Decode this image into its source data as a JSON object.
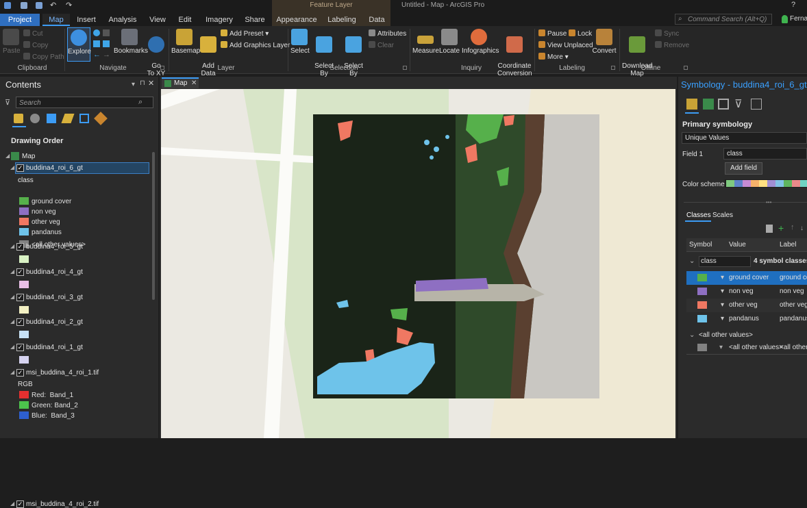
{
  "titlebar": {
    "title": "Untitled - Map - ArcGIS Pro",
    "help": "?"
  },
  "context_tab": {
    "label": "Feature Layer"
  },
  "tabs": [
    {
      "label": "Project"
    },
    {
      "label": "Map"
    },
    {
      "label": "Insert"
    },
    {
      "label": "Analysis"
    },
    {
      "label": "View"
    },
    {
      "label": "Edit"
    },
    {
      "label": "Imagery"
    },
    {
      "label": "Share"
    },
    {
      "label": "Appearance"
    },
    {
      "label": "Labeling"
    },
    {
      "label": "Data"
    }
  ],
  "command_search": {
    "placeholder": "Command Search (Alt+Q)"
  },
  "user": {
    "name": "Fernan"
  },
  "ribbon": {
    "clipboard": {
      "paste": "Paste",
      "cut": "Cut",
      "copy": "Copy",
      "copy_path": "Copy Path",
      "group": "Clipboard"
    },
    "navigate": {
      "explore": "Explore",
      "bookmarks": "Bookmarks",
      "go_to_xy": "Go\nTo XY",
      "group": "Navigate"
    },
    "layer": {
      "basemap": "Basemap",
      "add_data": "Add\nData",
      "add_preset": "Add Preset",
      "add_graphics": "Add Graphics Layer",
      "group": "Layer"
    },
    "selection": {
      "select": "Select",
      "select_by_attr": "Select By\nAttributes",
      "select_by_loc": "Select By\nLocation",
      "attributes": "Attributes",
      "clear": "Clear",
      "group": "Selection"
    },
    "inquiry": {
      "measure": "Measure",
      "locate": "Locate",
      "infographics": "Infographics",
      "coord_conv": "Coordinate\nConversion",
      "group": "Inquiry"
    },
    "labeling": {
      "pause": "Pause",
      "lock": "Lock",
      "view_unplaced": "View Unplaced",
      "more": "More",
      "group": "Labeling"
    },
    "offline": {
      "convert": "Convert",
      "download_map": "Download\nMap",
      "sync": "Sync",
      "remove": "Remove",
      "group": "Offline"
    }
  },
  "contents": {
    "title": "Contents",
    "search_placeholder": "Search",
    "drawing_order": "Drawing Order",
    "map_label": "Map",
    "layers": [
      {
        "name": "buddina4_roi_6_gt",
        "selected": true,
        "field": "class",
        "legend": [
          {
            "label": "ground cover",
            "color": "#56b04b"
          },
          {
            "label": "non veg",
            "color": "#8e6fc2"
          },
          {
            "label": "other veg",
            "color": "#f07862"
          },
          {
            "label": "pandanus",
            "color": "#6ec3ea"
          },
          {
            "label": "<all other values>",
            "color": "#828282"
          }
        ]
      },
      {
        "name": "buddina4_roi_5_gt",
        "swatch": "#d9f2c4"
      },
      {
        "name": "buddina4_roi_4_gt",
        "swatch": "#e8bfe6"
      },
      {
        "name": "buddina4_roi_3_gt",
        "swatch": "#f2f0c2"
      },
      {
        "name": "buddina4_roi_2_gt",
        "swatch": "#c7e1f5"
      },
      {
        "name": "buddina4_roi_1_gt",
        "swatch": "#d6d3f0"
      },
      {
        "name": "msi_buddina_4_roi_1.tif",
        "rgb_label": "RGB",
        "bands": [
          {
            "label": "Red:  Band_1",
            "color": "#e53030"
          },
          {
            "label": "Green: Band_2",
            "color": "#4cc24c"
          },
          {
            "label": "Blue:  Band_3",
            "color": "#2e5fcf"
          }
        ]
      },
      {
        "name": "msi_buddina_4_roi_2.tif"
      }
    ]
  },
  "map_tab": {
    "label": "Map"
  },
  "symbology": {
    "title": "Symbology - buddina4_roi_6_gt",
    "primary": "Primary symbology",
    "method": "Unique Values",
    "field1_label": "Field 1",
    "field1_value": "class",
    "add_field": "Add field",
    "color_scheme_label": "Color scheme",
    "color_scheme": [
      "#7fc97f",
      "#5e82c8",
      "#c78bd4",
      "#f6b26b",
      "#ffe082",
      "#a08fd4",
      "#82c2e5",
      "#5fb55f",
      "#e98a8a",
      "#6fd3c2"
    ],
    "tabs": [
      "Classes",
      "Scales"
    ],
    "columns": [
      "Symbol",
      "Value",
      "Label"
    ],
    "group_field": "class",
    "group_count": "4 symbol classes",
    "classes": [
      {
        "value": "ground cover",
        "label": "ground co",
        "color": "#56b04b",
        "selected": true
      },
      {
        "value": "non veg",
        "label": "non veg",
        "color": "#8e6fc2"
      },
      {
        "value": "other veg",
        "label": "other veg",
        "color": "#f07862"
      },
      {
        "value": "pandanus",
        "label": "pandanus",
        "color": "#6ec3ea"
      }
    ],
    "other_header": "<all other values>",
    "other_row": {
      "value": "<all other values>",
      "label": "<all other",
      "color": "#828282"
    }
  }
}
